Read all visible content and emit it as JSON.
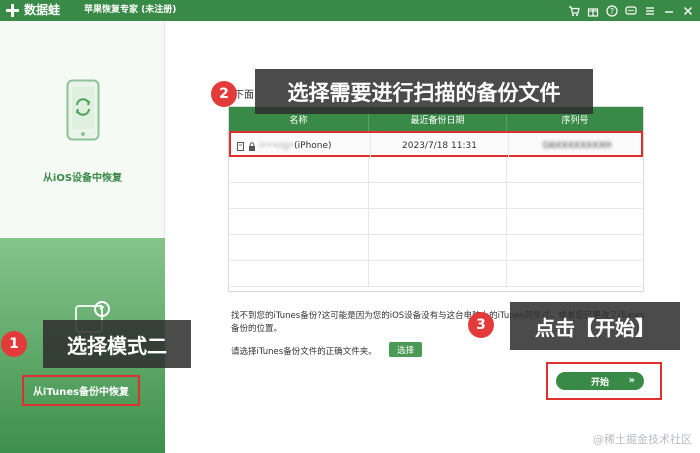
{
  "titlebar": {
    "app_name": "数据蛙",
    "window_title": "苹果恢复专家 (未注册)",
    "icons": [
      "cart-icon",
      "gift-icon",
      "help-icon",
      "chat-icon",
      "menu-icon",
      "minimize-icon",
      "close-icon"
    ]
  },
  "sidebar": {
    "mode1_label": "从iOS设备中恢复",
    "mode2_label": "从iTunes备份中恢复"
  },
  "main": {
    "prompt": "下面",
    "table": {
      "headers": [
        "名称",
        "最近备份日期",
        "序列号"
      ],
      "rows": [
        {
          "name_blurred": "i•••ng•",
          "name_suffix": "(iPhone)",
          "date": "2023/7/18 11:31",
          "serial_blurred": "G6XXXXXXXXH"
        }
      ]
    },
    "help_text": "找不到您的iTunes备份?这可能是因为您的iOS设备没有与这台电脑上的iTunes同步过，或者您已更改了iTunes备份的位置。",
    "choose_text": "请选择iTunes备份文件的正确文件夹。",
    "choose_button": "选择",
    "start_button": "开始",
    "start_arrow": "»"
  },
  "annotations": {
    "step1": {
      "number": "1",
      "text": "选择模式二"
    },
    "step2": {
      "number": "2",
      "text": "选择需要进行扫描的备份文件"
    },
    "step3": {
      "number": "3",
      "text": "点击【开始】"
    }
  },
  "watermark": "@稀土掘金技术社区",
  "colors": {
    "brand_green": "#3a8a47",
    "highlight_red": "#e02f2f",
    "badge_red": "#e33a3a"
  }
}
